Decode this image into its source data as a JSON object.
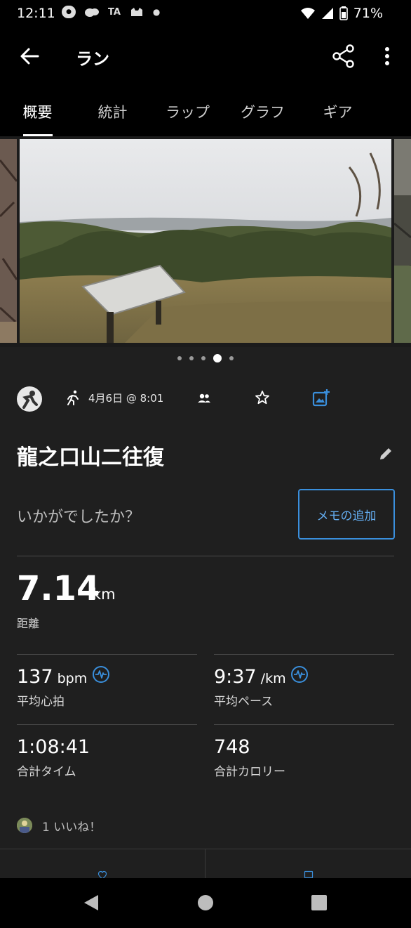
{
  "status_bar": {
    "time": "12:11",
    "notif_icons": [
      "line-icon",
      "cloud-chat-icon",
      "ta-icon",
      "cat-app-icon",
      "dot-icon"
    ],
    "ta_label": "TA",
    "battery": "71%"
  },
  "app_bar": {
    "title": "ラン"
  },
  "tabs": [
    {
      "label": "概要",
      "active": true
    },
    {
      "label": "統計",
      "active": false
    },
    {
      "label": "ラップ",
      "active": false
    },
    {
      "label": "グラフ",
      "active": false
    },
    {
      "label": "ギア",
      "active": false
    }
  ],
  "carousel": {
    "page_count": 5,
    "active_index": 3
  },
  "activity": {
    "date": "4月6日 @ 8:01",
    "title": "龍之口山二往復",
    "prompt": "いかがでしたか？",
    "memo_button": "メモの追加"
  },
  "distance": {
    "value": "7.14",
    "unit": "km",
    "label": "距離"
  },
  "stats": {
    "heart_rate": {
      "value": "137",
      "unit": " bpm",
      "label": "平均心拍"
    },
    "pace": {
      "value": "9:37",
      "unit": " /km",
      "label": "平均ペース"
    },
    "time": {
      "value": "1:08:41",
      "label": "合計タイム"
    },
    "calories": {
      "value": "748",
      "label": "合計カロリー"
    }
  },
  "likes": {
    "text": "1 いいね！"
  },
  "colors": {
    "accent_blue": "#3a8fdc",
    "background": "#1f1f1f",
    "bar_black": "#000000"
  }
}
